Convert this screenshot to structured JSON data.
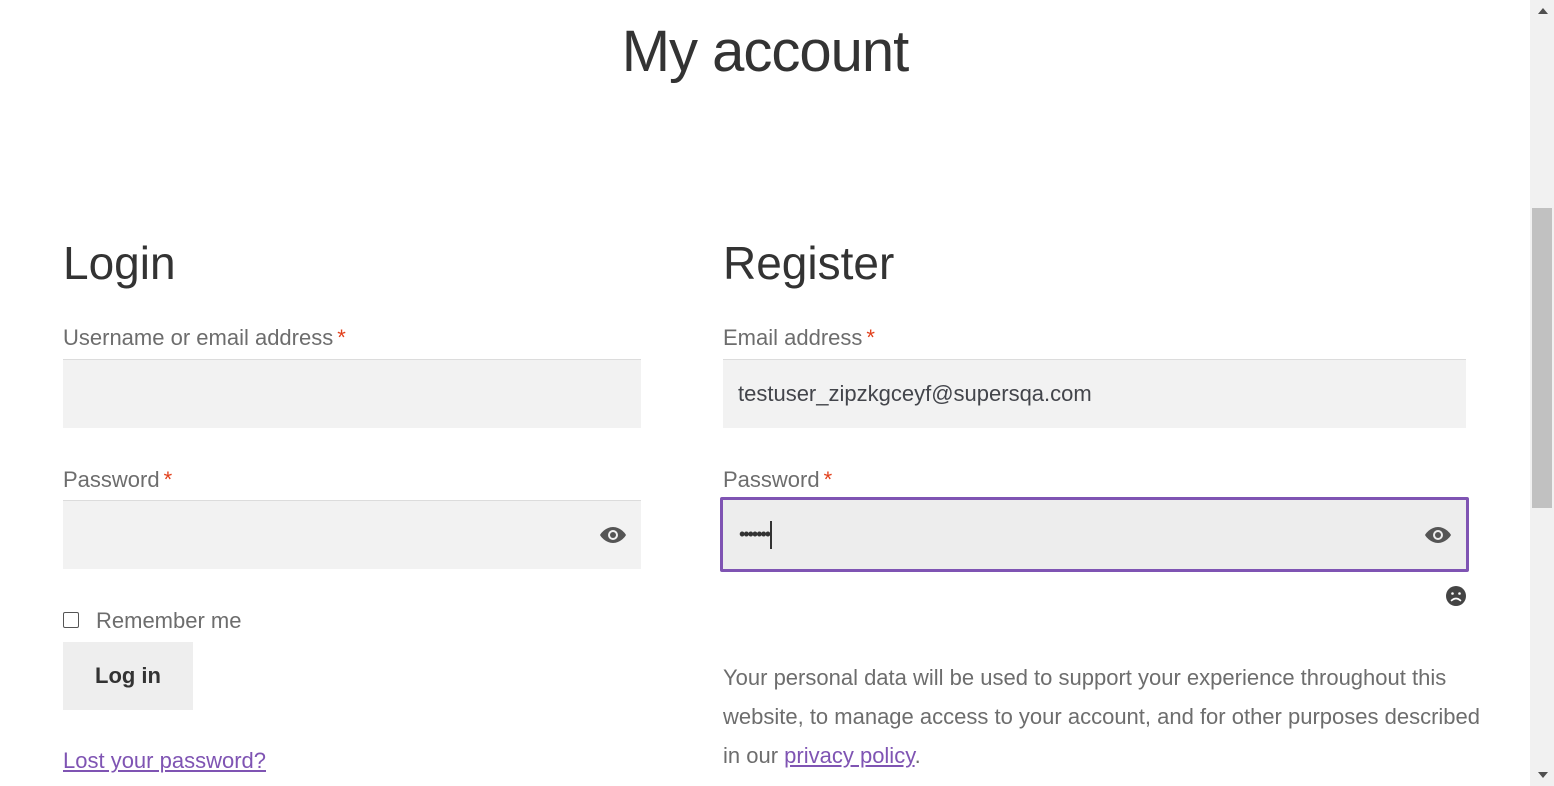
{
  "page": {
    "title": "My account"
  },
  "login": {
    "heading": "Login",
    "username_label": "Username or email address",
    "username_value": "",
    "password_label": "Password",
    "password_value": "",
    "required_mark": "*",
    "remember_label": "Remember me",
    "remember_checked": false,
    "login_button": "Log in",
    "lost_password_link": "Lost your password?"
  },
  "register": {
    "heading": "Register",
    "email_label": "Email address",
    "email_value": "testuser_zipzkgceyf@supersqa.com",
    "password_label": "Password",
    "password_value": "•••••••",
    "required_mark": "*",
    "strength_icon": "sad-face-icon",
    "privacy_text_before": "Your personal data will be used to support your experience throughout this website, to manage access to your account, and for other purposes described in our ",
    "privacy_link": "privacy policy",
    "privacy_text_after": "."
  },
  "colors": {
    "accent": "#7f54b3",
    "required": "#e2401c",
    "input_bg": "#f2f2f2",
    "heading": "#333333",
    "text": "#6d6d6d"
  },
  "icons": {
    "password_toggle": "eye-icon",
    "strength": "sad-face-icon"
  }
}
